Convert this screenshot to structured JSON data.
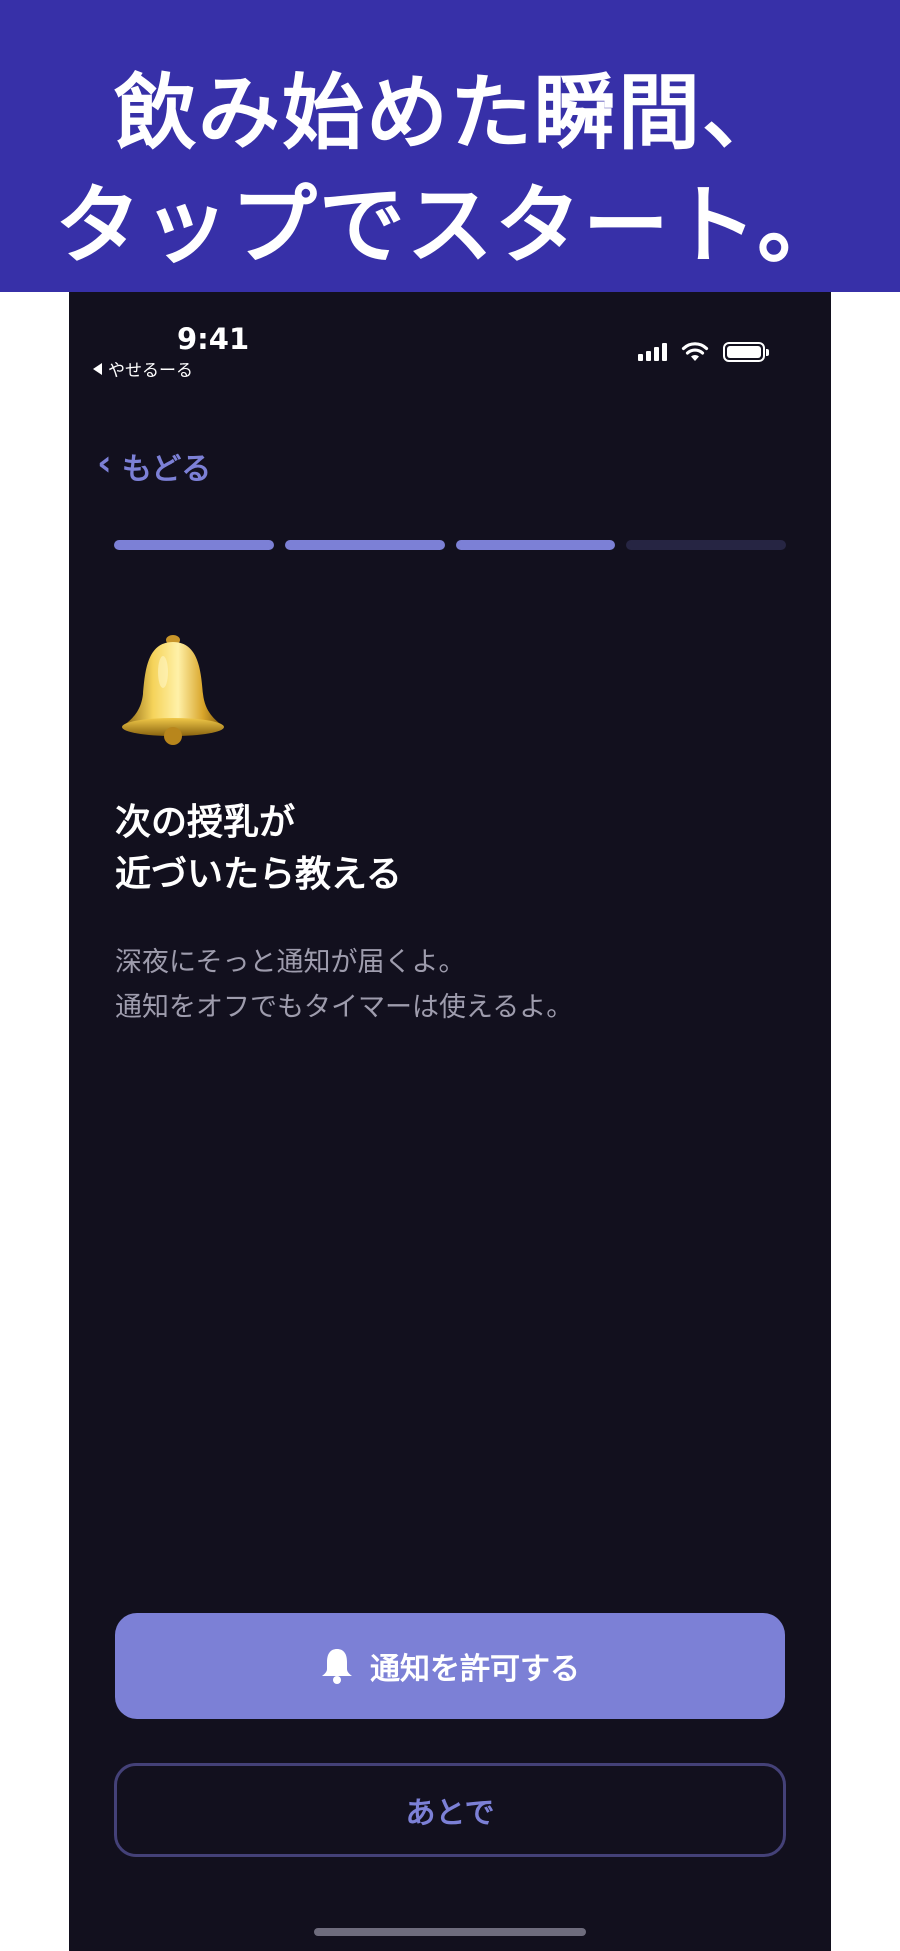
{
  "banner": {
    "line1": "飲み始めた瞬間、",
    "line2": "タップでスタート。"
  },
  "status_bar": {
    "time": "9:41",
    "back_app": "やせるーる",
    "icons": [
      "signal-icon",
      "wifi-icon",
      "battery-icon"
    ]
  },
  "nav": {
    "back_label": "もどる"
  },
  "progress": {
    "total_steps": 4,
    "completed_steps": 3
  },
  "main": {
    "icon": "bell-icon",
    "title_line1": "次の授乳が",
    "title_line2": "近づいたら教える",
    "desc_line1": "深夜にそっと通知が届くよ。",
    "desc_line2": "通知をオフでもタイマーは使えるよ。"
  },
  "actions": {
    "primary_label": "通知を許可する",
    "primary_icon": "bell-icon",
    "secondary_label": "あとで"
  },
  "colors": {
    "banner_bg": "#3730a8",
    "app_bg": "#12101e",
    "accent": "#7c80d6",
    "muted_text": "#9e9cad"
  }
}
